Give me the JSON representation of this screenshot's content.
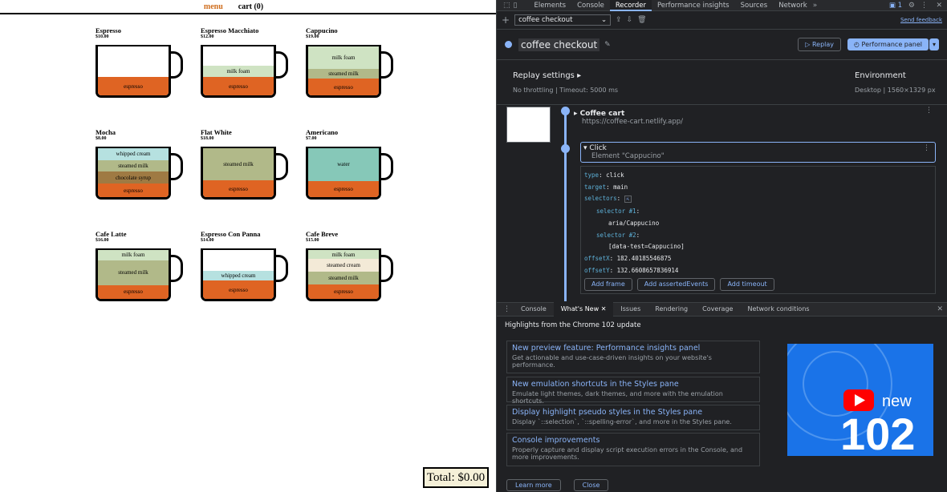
{
  "site": {
    "nav": {
      "menu": "menu",
      "cart": "cart (0)"
    },
    "items": [
      {
        "name": "Espresso",
        "price": "$10.00",
        "layers": [
          {
            "label": "espresso",
            "color": "#df6423",
            "h": 23
          }
        ]
      },
      {
        "name": "Espresso Macchiato",
        "price": "$12.00",
        "layers": [
          {
            "label": "milk foam",
            "color": "#cfe3c3",
            "h": 14
          },
          {
            "label": "espresso",
            "color": "#df6423",
            "h": 23
          }
        ]
      },
      {
        "name": "Cappucino",
        "price": "$19.00",
        "layers": [
          {
            "label": "milk foam",
            "color": "#cfe3c3",
            "h": 31
          },
          {
            "label": "steamed milk",
            "color": "#b1b989",
            "h": 14
          },
          {
            "label": "espresso",
            "color": "#df6423",
            "h": 23
          }
        ]
      },
      {
        "name": "Mocha",
        "price": "$8.00",
        "layers": [
          {
            "label": "whipped cream",
            "color": "#b6e1e0",
            "h": 20
          },
          {
            "label": "steamed milk",
            "color": "#b1b989",
            "h": 20
          },
          {
            "label": "chocolate syrup",
            "color": "#9f7a43",
            "h": 20
          },
          {
            "label": "espresso",
            "color": "#df6423",
            "h": 23
          }
        ]
      },
      {
        "name": "Flat White",
        "price": "$18.00",
        "layers": [
          {
            "label": "steamed milk",
            "color": "#b1b989",
            "h": 44
          },
          {
            "label": "espresso",
            "color": "#df6423",
            "h": 23
          }
        ]
      },
      {
        "name": "Americano",
        "price": "$7.00",
        "layers": [
          {
            "label": "water",
            "color": "#86c8b8",
            "h": 46
          },
          {
            "label": "espresso",
            "color": "#df6423",
            "h": 23
          }
        ]
      },
      {
        "name": "Cafe Latte",
        "price": "$16.00",
        "layers": [
          {
            "label": "milk foam",
            "color": "#cfe3c3",
            "h": 17
          },
          {
            "label": "steamed milk",
            "color": "#b1b989",
            "h": 42
          },
          {
            "label": "espresso",
            "color": "#df6423",
            "h": 23
          }
        ]
      },
      {
        "name": "Espresso Con Panna",
        "price": "$14.00",
        "layers": [
          {
            "label": "whipped cream",
            "color": "#b6e1e0",
            "h": 12
          },
          {
            "label": "espresso",
            "color": "#df6423",
            "h": 23
          }
        ]
      },
      {
        "name": "Cafe Breve",
        "price": "$15.00",
        "layers": [
          {
            "label": "milk foam",
            "color": "#cfe3c3",
            "h": 14
          },
          {
            "label": "steamed cream",
            "color": "#f3ead7",
            "h": 20
          },
          {
            "label": "steamed milk",
            "color": "#b1b989",
            "h": 20
          },
          {
            "label": "espresso",
            "color": "#df6423",
            "h": 23
          }
        ]
      }
    ],
    "total": "Total: $0.00"
  },
  "devtools": {
    "tabs": [
      "Elements",
      "Console",
      "Recorder",
      "Performance insights",
      "Sources",
      "Network"
    ],
    "active_tab": "Recorder",
    "badge": "1",
    "recording_select": "coffee checkout",
    "send_feedback": "Send feedback",
    "recording_title": "coffee checkout",
    "replay": "Replay",
    "perf_panel": "Performance panel",
    "replay_settings": "Replay settings",
    "throttling": "No throttling",
    "timeout": "Timeout: 5000 ms",
    "environment": "Environment",
    "env_value": "Desktop",
    "env_size": "1560×1329 px",
    "step1": {
      "title": "Coffee cart",
      "url": "https://coffee-cart.netlify.app/"
    },
    "step2": {
      "title": "Click",
      "subtitle": "Element \"Cappucino\""
    },
    "code": {
      "type_k": "type",
      "type_v": "click",
      "target_k": "target",
      "target_v": "main",
      "selectors_k": "selectors",
      "sel1_k": "selector #1",
      "sel1_v": "aria/Cappucino",
      "sel2_k": "selector #2",
      "sel2_v": "[data-test=Cappucino]",
      "offx_k": "offsetX",
      "offx_v": "182.40185546875",
      "offy_k": "offsetY",
      "offy_v": "132.6608657836914"
    },
    "add_frame": "Add frame",
    "add_asserted": "Add assertedEvents",
    "add_timeout": "Add timeout",
    "drawer_tabs": [
      "Console",
      "What's New",
      "Issues",
      "Rendering",
      "Coverage",
      "Network conditions"
    ],
    "drawer_active": "What's New",
    "highlights": "Highlights from the Chrome 102 update",
    "news": [
      {
        "title": "New preview feature: Performance insights panel",
        "desc": "Get actionable and use-case-driven insights on your website's performance."
      },
      {
        "title": "New emulation shortcuts in the Styles pane",
        "desc": "Emulate light themes, dark themes, and more with the emulation shortcuts."
      },
      {
        "title": "Display highlight pseudo styles in the Styles pane",
        "desc": "Display `::selection`, `::spelling-error`, and more in the Styles pane."
      },
      {
        "title": "Console improvements",
        "desc": "Properly capture and display script execution errors in the Console, and more improvements."
      }
    ],
    "promo_new": "new",
    "promo_num": "102",
    "learn_more": "Learn more",
    "close": "Close"
  }
}
